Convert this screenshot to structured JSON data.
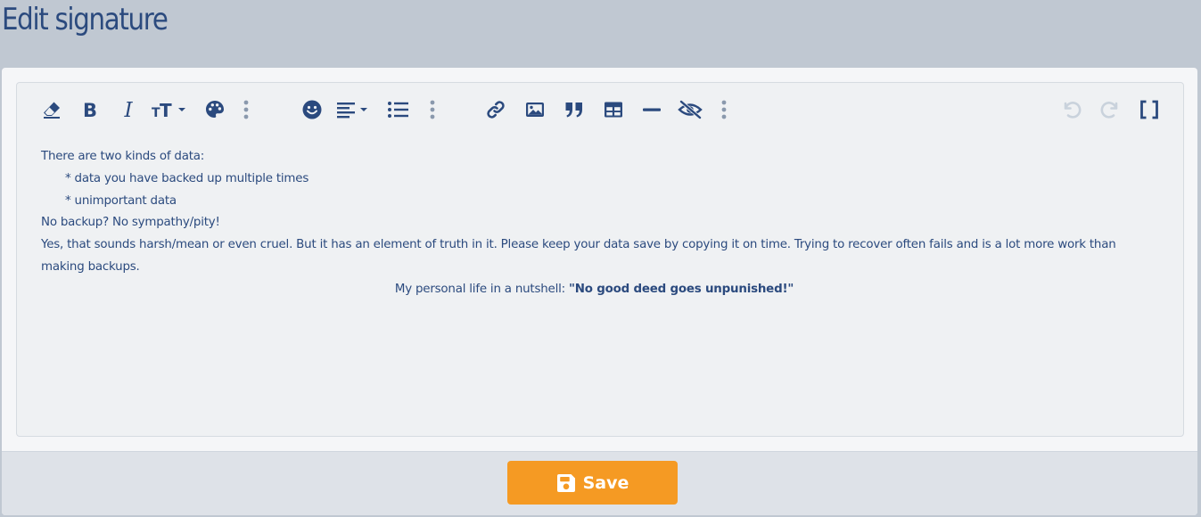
{
  "page": {
    "title": "Edit signature"
  },
  "editor": {
    "lines": {
      "l1": "There are two kinds of data:",
      "l2": "* data you have backed up multiple times",
      "l3": "* unimportant data",
      "l4": "No backup? No sympathy/pity!",
      "l5": "Yes, that sounds harsh/mean or even cruel. But it has an element of truth in it. Please keep your data save by copying it on time. Trying to recover often fails and is a lot more work than making backups.",
      "l6_prefix": "My personal life in a nutshell: ",
      "l6_bold": "\"No good deed goes unpunished!\""
    }
  },
  "footer": {
    "save_label": "Save"
  },
  "colors": {
    "title": "#2b4a7e",
    "toolbar_icon": "#2b4a7e",
    "toolbar_more": "#8a99ad",
    "toolbar_disabled": "#c9d2dc",
    "save_button": "#f59a23",
    "background": "#c0c8d2"
  },
  "toolbar": {
    "icons": [
      "eraser-icon",
      "bold-icon",
      "italic-icon",
      "text-size-icon",
      "palette-icon",
      "more-icon",
      "smiley-icon",
      "align-icon",
      "list-icon",
      "more-icon",
      "link-icon",
      "image-icon",
      "quote-icon",
      "table-icon",
      "horizontal-rule-icon",
      "spoiler-icon",
      "more-icon",
      "undo-icon",
      "redo-icon",
      "bbcode-toggle-icon"
    ]
  }
}
